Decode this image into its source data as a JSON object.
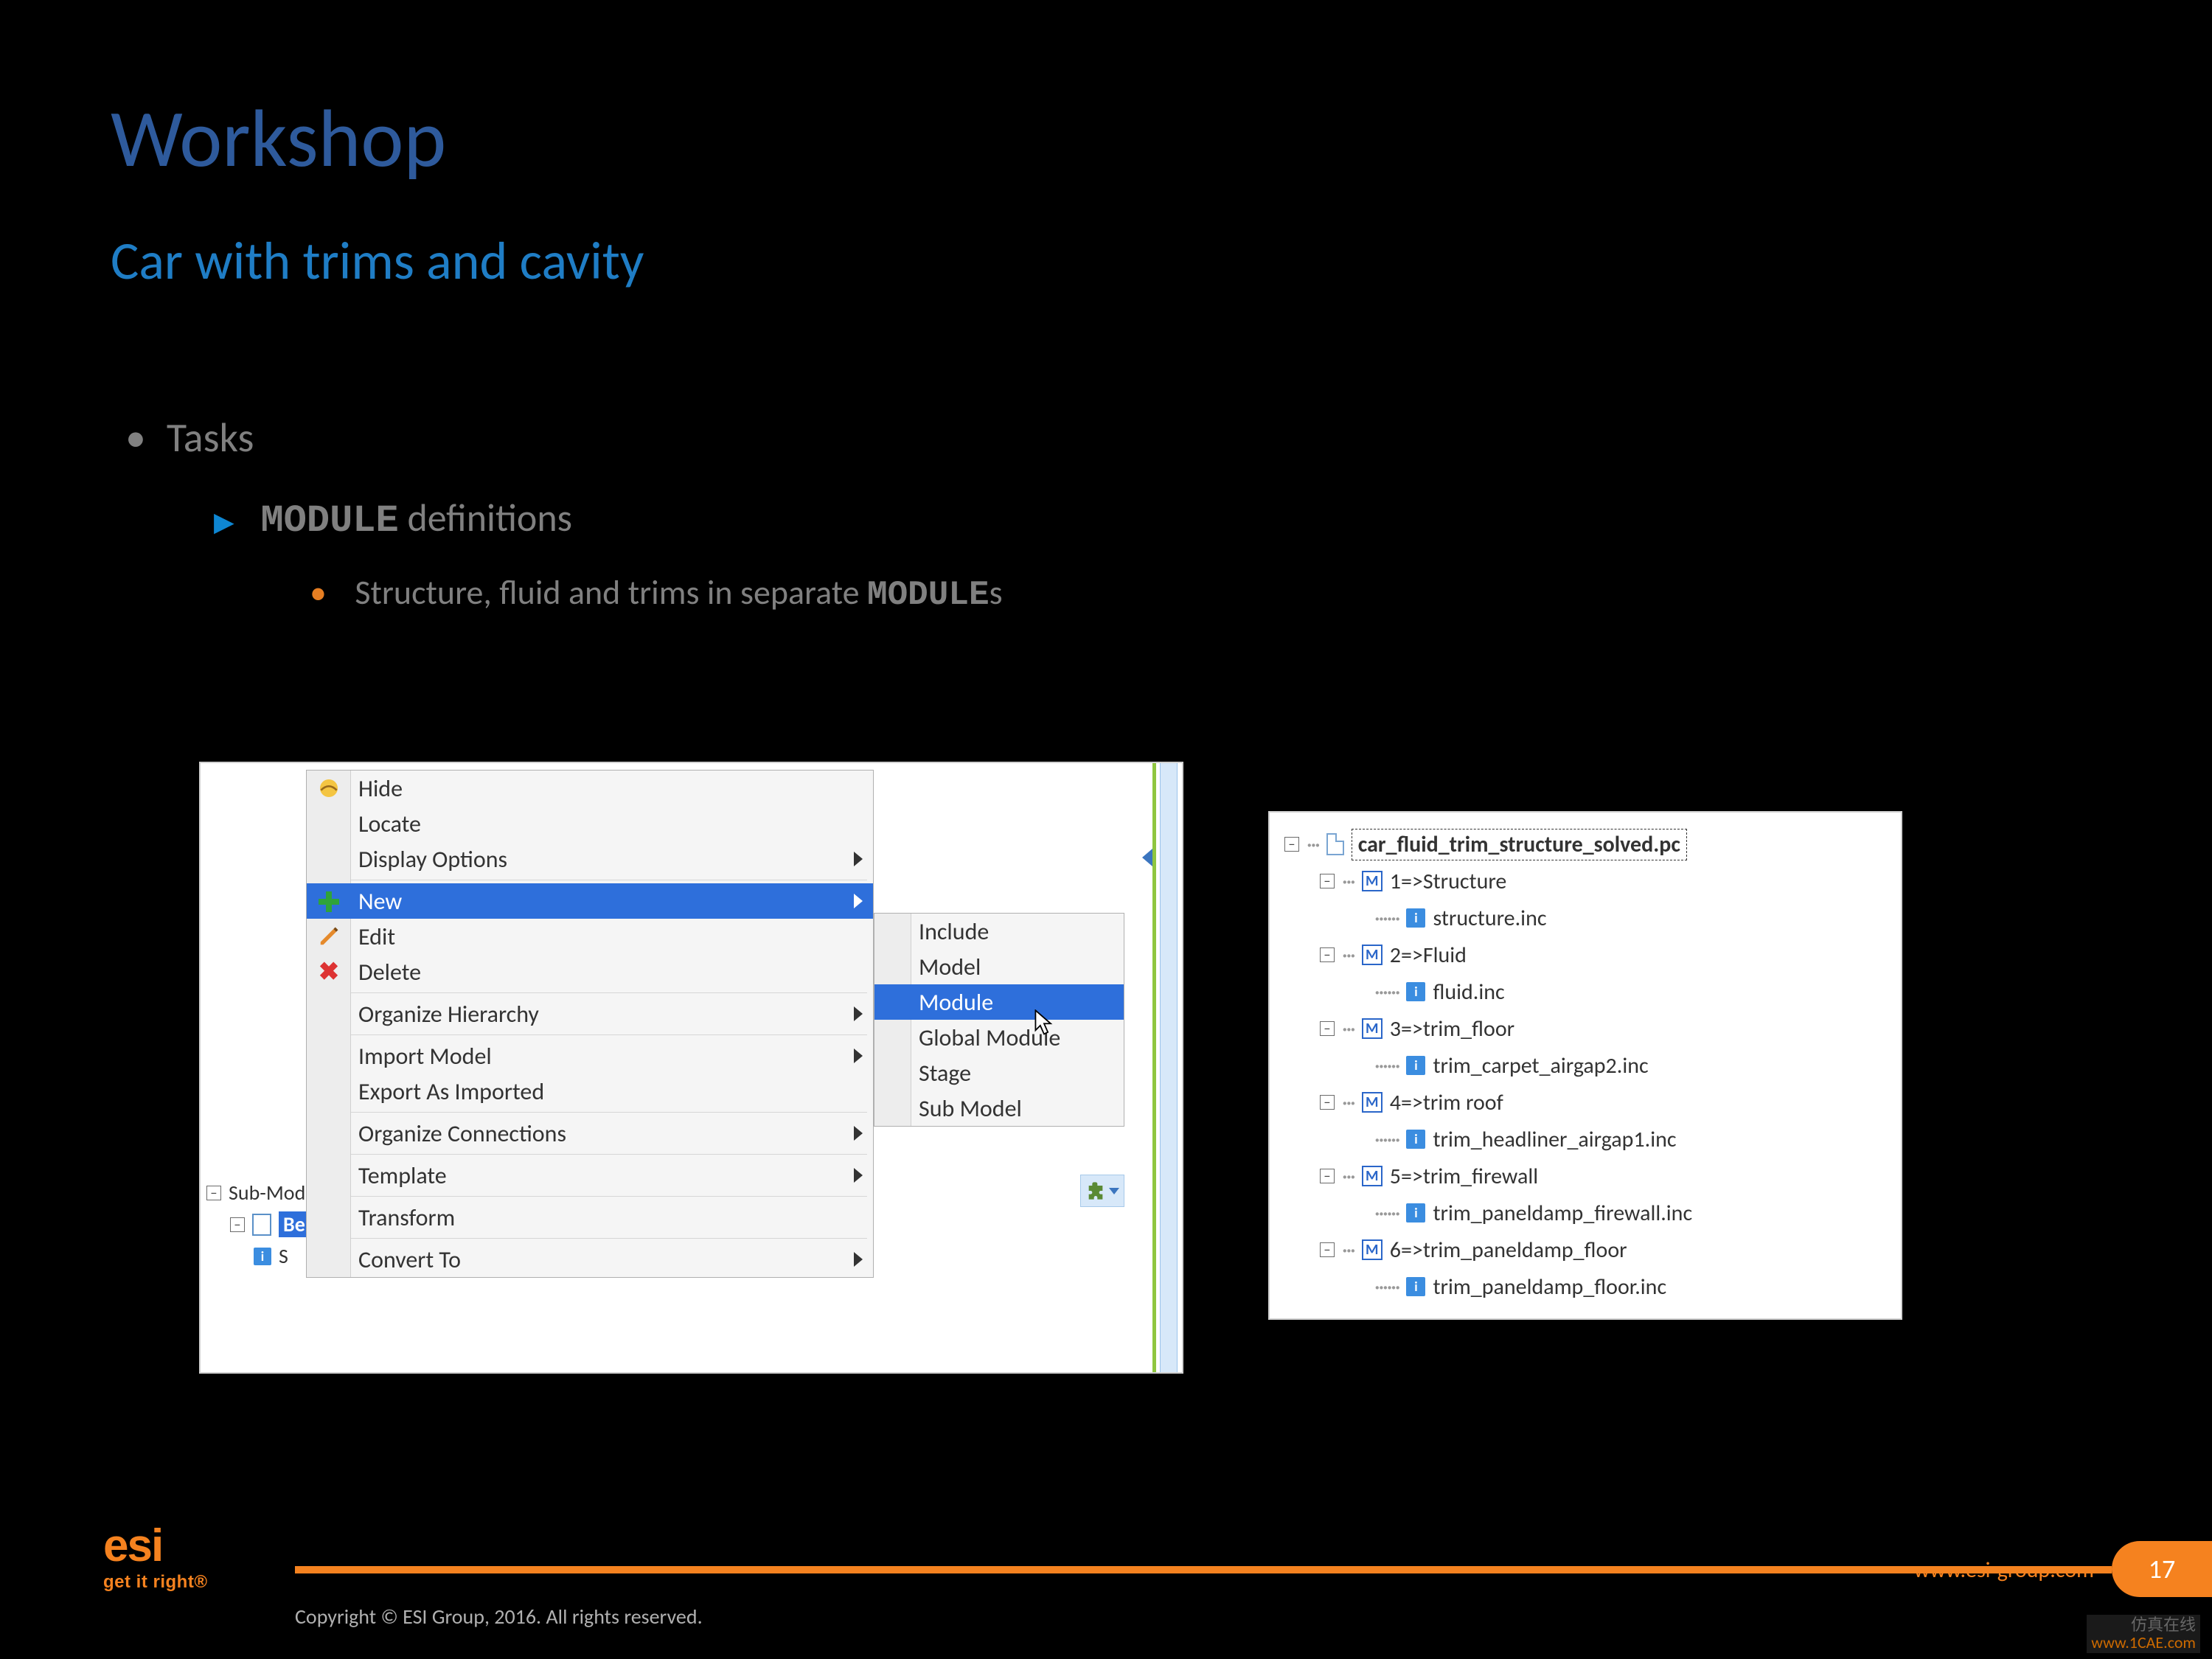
{
  "slide": {
    "title": "Workshop",
    "subtitle": "Car with trims and cavity",
    "bullet1": "Tasks",
    "bullet2_mono": "MODULE",
    "bullet2_rest": "  definitions",
    "bullet3_pre": "Structure, fluid and trims in separate ",
    "bullet3_mono": "MODULE",
    "bullet3_post": "s"
  },
  "left_tree": {
    "sub_label": "Sub-Mod",
    "selected": "Beis",
    "trailing": "S"
  },
  "context_menu": {
    "items": [
      {
        "label": "Hide",
        "icon": "hide",
        "submenu": false,
        "hl": false
      },
      {
        "label": "Locate",
        "icon": "",
        "submenu": false,
        "hl": false
      },
      {
        "label": "Display Options",
        "icon": "",
        "submenu": true,
        "hl": false,
        "sep_after": true
      },
      {
        "label": "New",
        "icon": "plus",
        "submenu": true,
        "hl": true
      },
      {
        "label": "Edit",
        "icon": "pencil",
        "submenu": false,
        "hl": false
      },
      {
        "label": "Delete",
        "icon": "x",
        "submenu": false,
        "hl": false,
        "sep_after": true
      },
      {
        "label": "Organize Hierarchy",
        "icon": "",
        "submenu": true,
        "hl": false,
        "sep_after": true
      },
      {
        "label": "Import Model",
        "icon": "",
        "submenu": true,
        "hl": false
      },
      {
        "label": "Export As Imported",
        "icon": "",
        "submenu": false,
        "hl": false,
        "sep_after": true
      },
      {
        "label": "Organize Connections",
        "icon": "",
        "submenu": true,
        "hl": false,
        "sep_after": true
      },
      {
        "label": "Template",
        "icon": "",
        "submenu": true,
        "hl": false,
        "sep_after": true
      },
      {
        "label": "Transform",
        "icon": "",
        "submenu": false,
        "hl": false,
        "sep_after": true
      },
      {
        "label": "Convert To",
        "icon": "",
        "submenu": true,
        "hl": false
      }
    ]
  },
  "submenu": {
    "items": [
      {
        "label": "Include",
        "hl": false
      },
      {
        "label": "Model",
        "hl": false
      },
      {
        "label": "Module",
        "hl": true
      },
      {
        "label": "Global Module",
        "hl": false
      },
      {
        "label": "Stage",
        "hl": false
      },
      {
        "label": "Sub Model",
        "hl": false
      }
    ]
  },
  "tree": [
    {
      "depth": 0,
      "exp": "-",
      "kind": "doc",
      "label": "car_fluid_trim_structure_solved.pc",
      "root": true
    },
    {
      "depth": 1,
      "exp": "-",
      "kind": "m",
      "label": "1=>Structure"
    },
    {
      "depth": 2,
      "exp": "",
      "kind": "i",
      "label": "structure.inc"
    },
    {
      "depth": 1,
      "exp": "-",
      "kind": "m",
      "label": "2=>Fluid"
    },
    {
      "depth": 2,
      "exp": "",
      "kind": "i",
      "label": "fluid.inc"
    },
    {
      "depth": 1,
      "exp": "-",
      "kind": "m",
      "label": "3=>trim_floor"
    },
    {
      "depth": 2,
      "exp": "",
      "kind": "i",
      "label": "trim_carpet_airgap2.inc"
    },
    {
      "depth": 1,
      "exp": "-",
      "kind": "m",
      "label": "4=>trim roof"
    },
    {
      "depth": 2,
      "exp": "",
      "kind": "i",
      "label": "trim_headliner_airgap1.inc"
    },
    {
      "depth": 1,
      "exp": "-",
      "kind": "m",
      "label": "5=>trim_firewall"
    },
    {
      "depth": 2,
      "exp": "",
      "kind": "i",
      "label": "trim_paneldamp_firewall.inc"
    },
    {
      "depth": 1,
      "exp": "-",
      "kind": "m",
      "label": "6=>trim_paneldamp_floor"
    },
    {
      "depth": 2,
      "exp": "",
      "kind": "i",
      "label": "trim_paneldamp_floor.inc"
    }
  ],
  "footer": {
    "logo_main": "esi",
    "logo_tag": "get it right®",
    "url": "www.esi-group.com",
    "page": "17",
    "copyright": "Copyright © ESI Group, 2016. All rights reserved."
  },
  "watermark": {
    "l1": "仿真在线",
    "l2": "www.1CAE.com"
  }
}
